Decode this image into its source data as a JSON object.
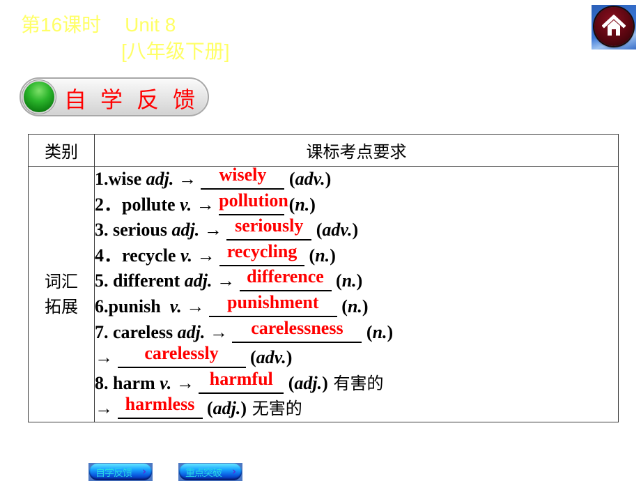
{
  "header": {
    "lesson": "第16课时",
    "unit": "Unit 8",
    "book": "[八年级下册]",
    "home_icon": "home-icon"
  },
  "section": {
    "title": "自学反馈",
    "indicator_icon": "green-dot-icon"
  },
  "table": {
    "headers": [
      "类别",
      "课标考点要求"
    ],
    "category": [
      "词汇",
      "拓展"
    ],
    "rows": [
      {
        "pre": "1.wise ",
        "pos": "adj.",
        "arrow": " → ",
        "answer": "wisely",
        "post_pos": "adv."
      },
      {
        "pre": "2．pollute ",
        "pos": "v.",
        "arrow": " → ",
        "answer": "pollution",
        "post_pos": "n."
      },
      {
        "pre": "3. serious ",
        "pos": "adj.",
        "arrow": " → ",
        "answer": "seriously",
        "post_pos": "adv."
      },
      {
        "pre": "4．recycle ",
        "pos": "v.",
        "arrow": " → ",
        "answer": "recycling",
        "post_pos": "n."
      },
      {
        "pre": "5. different ",
        "pos": "adj.",
        "arrow": " → ",
        "answer": "difference",
        "post_pos": "n."
      },
      {
        "pre": "6.punish  ",
        "pos": "v.",
        "arrow": " → ",
        "answer": "punishment",
        "post_pos": "n."
      },
      {
        "pre": "7. careless ",
        "pos": "adj.",
        "arrow": " → ",
        "answer": "carelessness",
        "post_pos": "n."
      },
      {
        "pre": "",
        "pos": "",
        "arrow": "→ ",
        "answer": "carelessly",
        "post_pos": "adv."
      },
      {
        "pre": "8. harm ",
        "pos": "v.",
        "arrow": " → ",
        "answer": "harmful",
        "post_pos": "adj.",
        "meaning": "有害的"
      },
      {
        "pre": "",
        "pos": "",
        "arrow": "→ ",
        "answer": "harmless",
        "post_pos": "adj.",
        "meaning": "无害的"
      }
    ]
  },
  "nav": {
    "buttons": [
      {
        "label": "自学反馈",
        "chevron": "›"
      },
      {
        "label": "重点突破",
        "chevron": "›"
      }
    ]
  },
  "colors": {
    "title_yellow": "#ffff66",
    "answer_red": "#ff0000",
    "section_red": "#ff0000"
  }
}
